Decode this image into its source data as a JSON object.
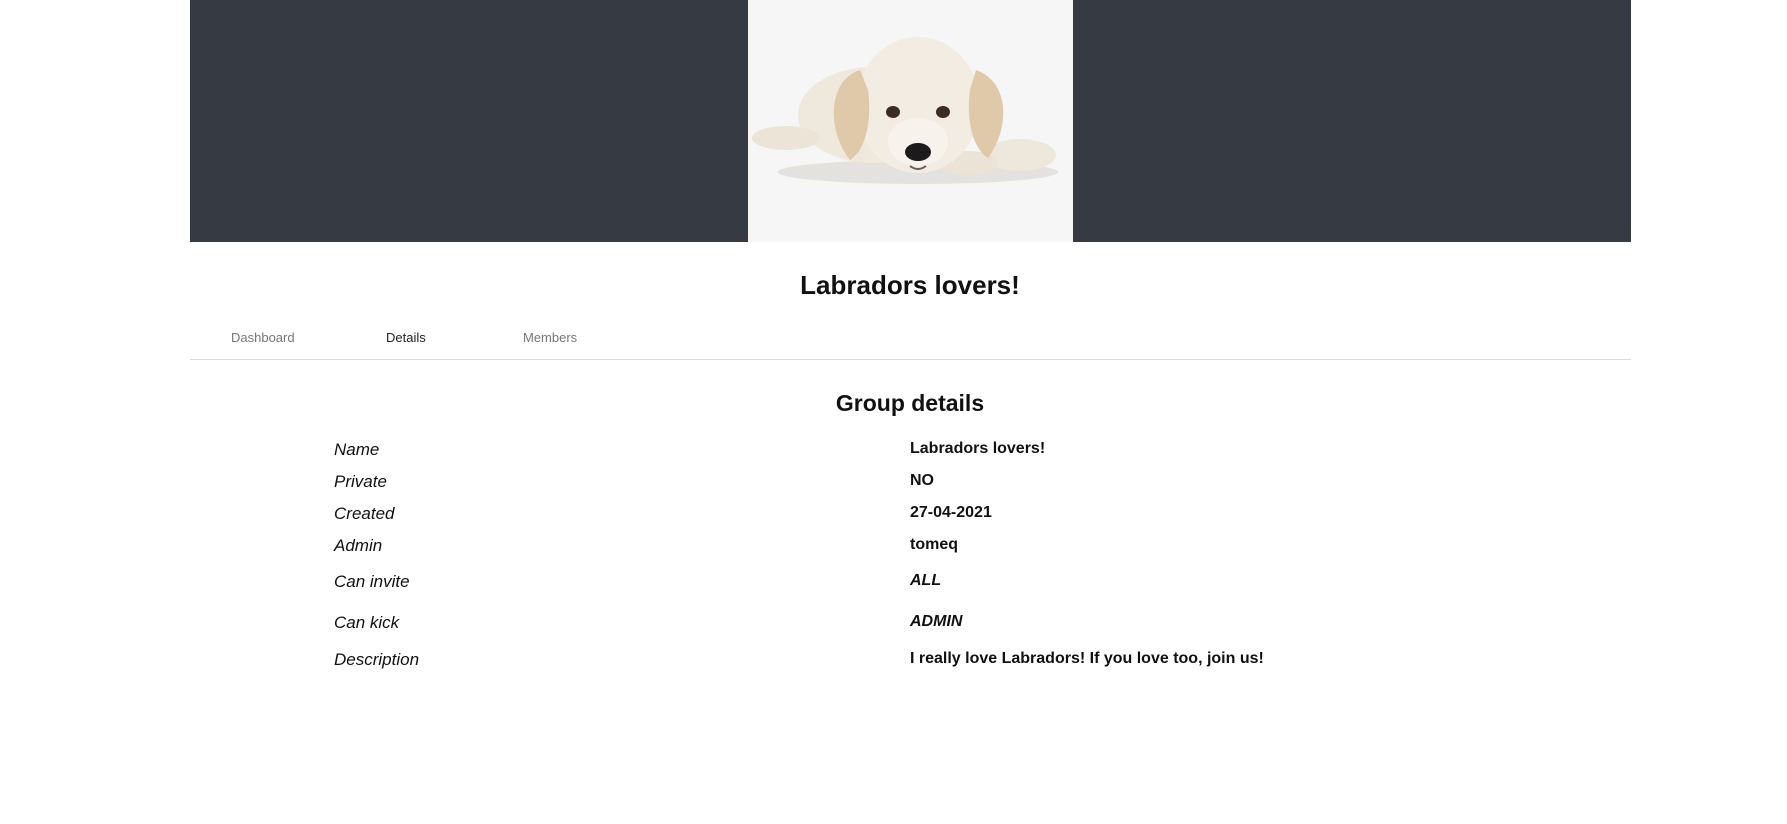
{
  "group": {
    "title": "Labradors lovers!",
    "banner_image": "puppy-photo"
  },
  "tabs": [
    {
      "label": "Dashboard",
      "active": false
    },
    {
      "label": "Details",
      "active": true
    },
    {
      "label": "Members",
      "active": false
    }
  ],
  "details": {
    "heading": "Group details",
    "rows": [
      {
        "label": "Name",
        "value": "Labradors lovers!"
      },
      {
        "label": "Private",
        "value": "NO"
      },
      {
        "label": "Created",
        "value": "27-04-2021"
      },
      {
        "label": "Admin",
        "value": "tomeq"
      },
      {
        "label": "Can invite",
        "value": "ALL"
      },
      {
        "label": "Can kick",
        "value": "ADMIN"
      },
      {
        "label": "Description",
        "value": "I really love Labradors! If you love too, join us!"
      }
    ]
  },
  "colors": {
    "banner_bg": "#363a43",
    "image_bg": "#f6f6f6"
  }
}
